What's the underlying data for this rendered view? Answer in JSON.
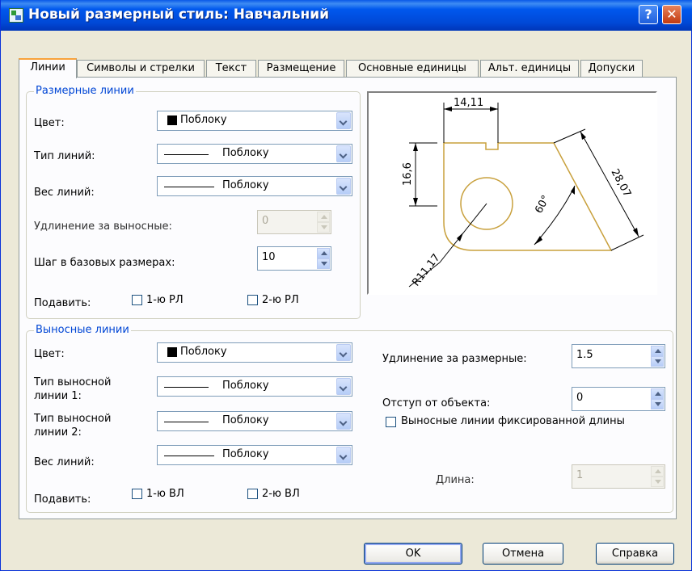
{
  "window": {
    "title": "Новый размерный стиль: Навчальний",
    "help_label": "?",
    "close_label": "✕"
  },
  "tabs": [
    {
      "label": "Линии"
    },
    {
      "label": "Символы и стрелки"
    },
    {
      "label": "Текст"
    },
    {
      "label": "Размещение"
    },
    {
      "label": "Основные единицы"
    },
    {
      "label": "Альт. единицы"
    },
    {
      "label": "Допуски"
    }
  ],
  "dim_lines": {
    "legend": "Размерные линии",
    "color_label": "Цвет:",
    "color_value": "Поблоку",
    "linetype_label": "Тип линий:",
    "linetype_value": "Поблоку",
    "lineweight_label": "Вес линий:",
    "lineweight_value": "Поблоку",
    "extend_label": "Удлинение за выносные:",
    "extend_value": "0",
    "baseline_label": "Шаг в базовых размерах:",
    "baseline_value": "10",
    "suppress_label": "Подавить:",
    "suppress_1": "1-ю РЛ",
    "suppress_2": "2-ю РЛ"
  },
  "ext_lines": {
    "legend": "Выносные линии",
    "color_label": "Цвет:",
    "color_value": "Поблоку",
    "linetype1_label_a": "Тип выносной",
    "linetype1_label_b": "линии 1:",
    "linetype1_value": "Поблоку",
    "linetype2_label_a": "Тип выносной",
    "linetype2_label_b": "линии 2:",
    "linetype2_value": "Поблоку",
    "lineweight_label": "Вес линий:",
    "lineweight_value": "Поблоку",
    "suppress_label": "Подавить:",
    "suppress_1": "1-ю ВЛ",
    "suppress_2": "2-ю ВЛ",
    "extend_beyond_label": "Удлинение за размерные:",
    "extend_beyond_value": "1.5",
    "offset_label": "Отступ от объекта:",
    "offset_value": "0",
    "fixed_label": "Выносные линии фиксированной длины",
    "length_label": "Длина:",
    "length_value": "1"
  },
  "preview": {
    "dim_top": "14,11",
    "dim_left": "16,6",
    "dim_right": "28,07",
    "dim_angle": "60°",
    "dim_radius": "R11,17"
  },
  "buttons": {
    "ok": "OK",
    "cancel": "Отмена",
    "help": "Справка"
  },
  "colors": {
    "title_bar": "#0054e3",
    "legend_text": "#0046d5",
    "geometry": "#c8a03c",
    "face": "#ece9d8"
  }
}
